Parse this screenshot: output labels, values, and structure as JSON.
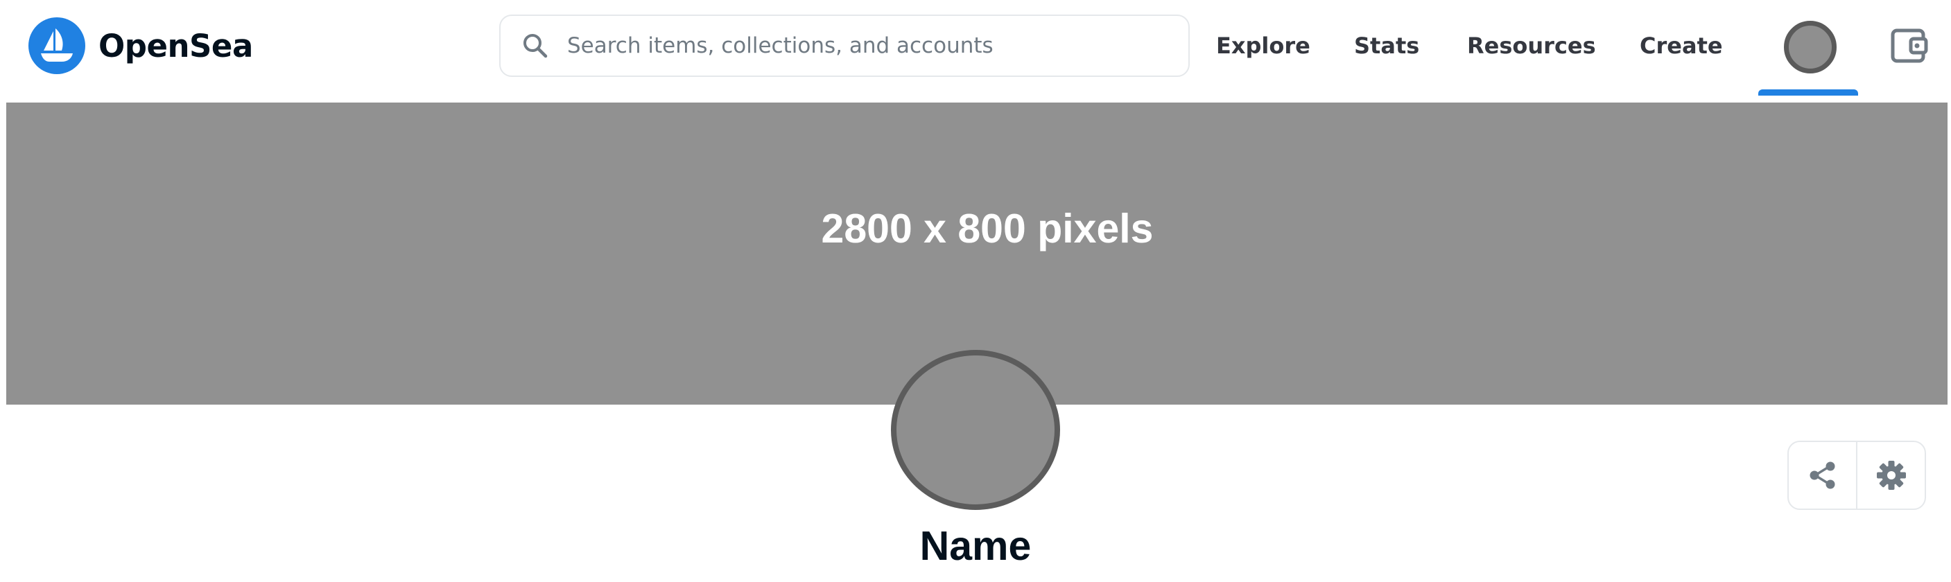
{
  "header": {
    "logo_text": "OpenSea",
    "search": {
      "placeholder": "Search items, collections, and accounts",
      "value": ""
    },
    "nav": [
      {
        "label": "Explore"
      },
      {
        "label": "Stats"
      },
      {
        "label": "Resources"
      },
      {
        "label": "Create"
      }
    ],
    "profile_icon": "account-avatar-icon",
    "wallet_icon": "wallet-icon",
    "active_indicator_color": "#2081e2"
  },
  "banner": {
    "text": "2800 x 800 pixels",
    "color": "#919191"
  },
  "profile": {
    "name": "Name",
    "avatar_color": "#8f8f8f",
    "actions": [
      {
        "icon": "share-icon"
      },
      {
        "icon": "settings-gear-icon"
      }
    ]
  },
  "colors": {
    "brand": "#2081e2",
    "text_primary": "#04111d",
    "text_nav": "#353840",
    "border": "#e5e8eb",
    "icon_gray": "#707a83"
  }
}
